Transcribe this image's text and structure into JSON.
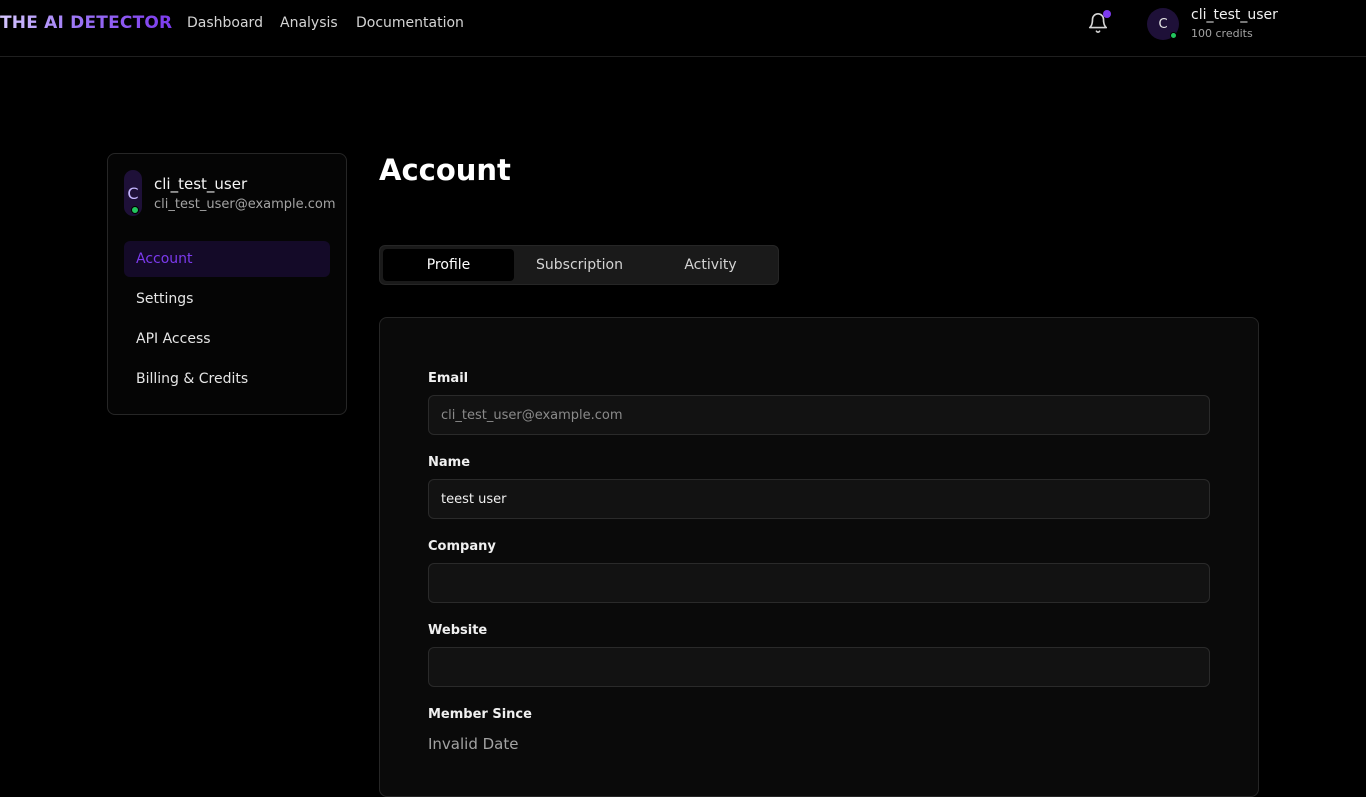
{
  "brand": "THE AI DETECTOR",
  "nav": {
    "links": [
      "Dashboard",
      "Analysis",
      "Documentation"
    ],
    "avatar_initial": "C",
    "username": "cli_test_user",
    "credits": "100 credits"
  },
  "sidebar": {
    "avatar_initial": "C",
    "name": "cli_test_user",
    "email": "cli_test_user@example.com",
    "items": [
      {
        "label": "Account",
        "active": true
      },
      {
        "label": "Settings",
        "active": false
      },
      {
        "label": "API Access",
        "active": false
      },
      {
        "label": "Billing & Credits",
        "active": false
      }
    ]
  },
  "main": {
    "title": "Account",
    "tabs": [
      {
        "label": "Profile",
        "active": true
      },
      {
        "label": "Subscription",
        "active": false
      },
      {
        "label": "Activity",
        "active": false
      }
    ],
    "form": {
      "email_label": "Email",
      "email_value": "cli_test_user@example.com",
      "name_label": "Name",
      "name_value": "teest user",
      "company_label": "Company",
      "company_value": "",
      "website_label": "Website",
      "website_value": "",
      "member_since_label": "Member Since",
      "member_since_value": "Invalid Date"
    }
  },
  "colors": {
    "accent": "#7c3aed",
    "online": "#22c55e",
    "background": "#000000"
  },
  "icons": {
    "notifications": "bell-icon"
  }
}
